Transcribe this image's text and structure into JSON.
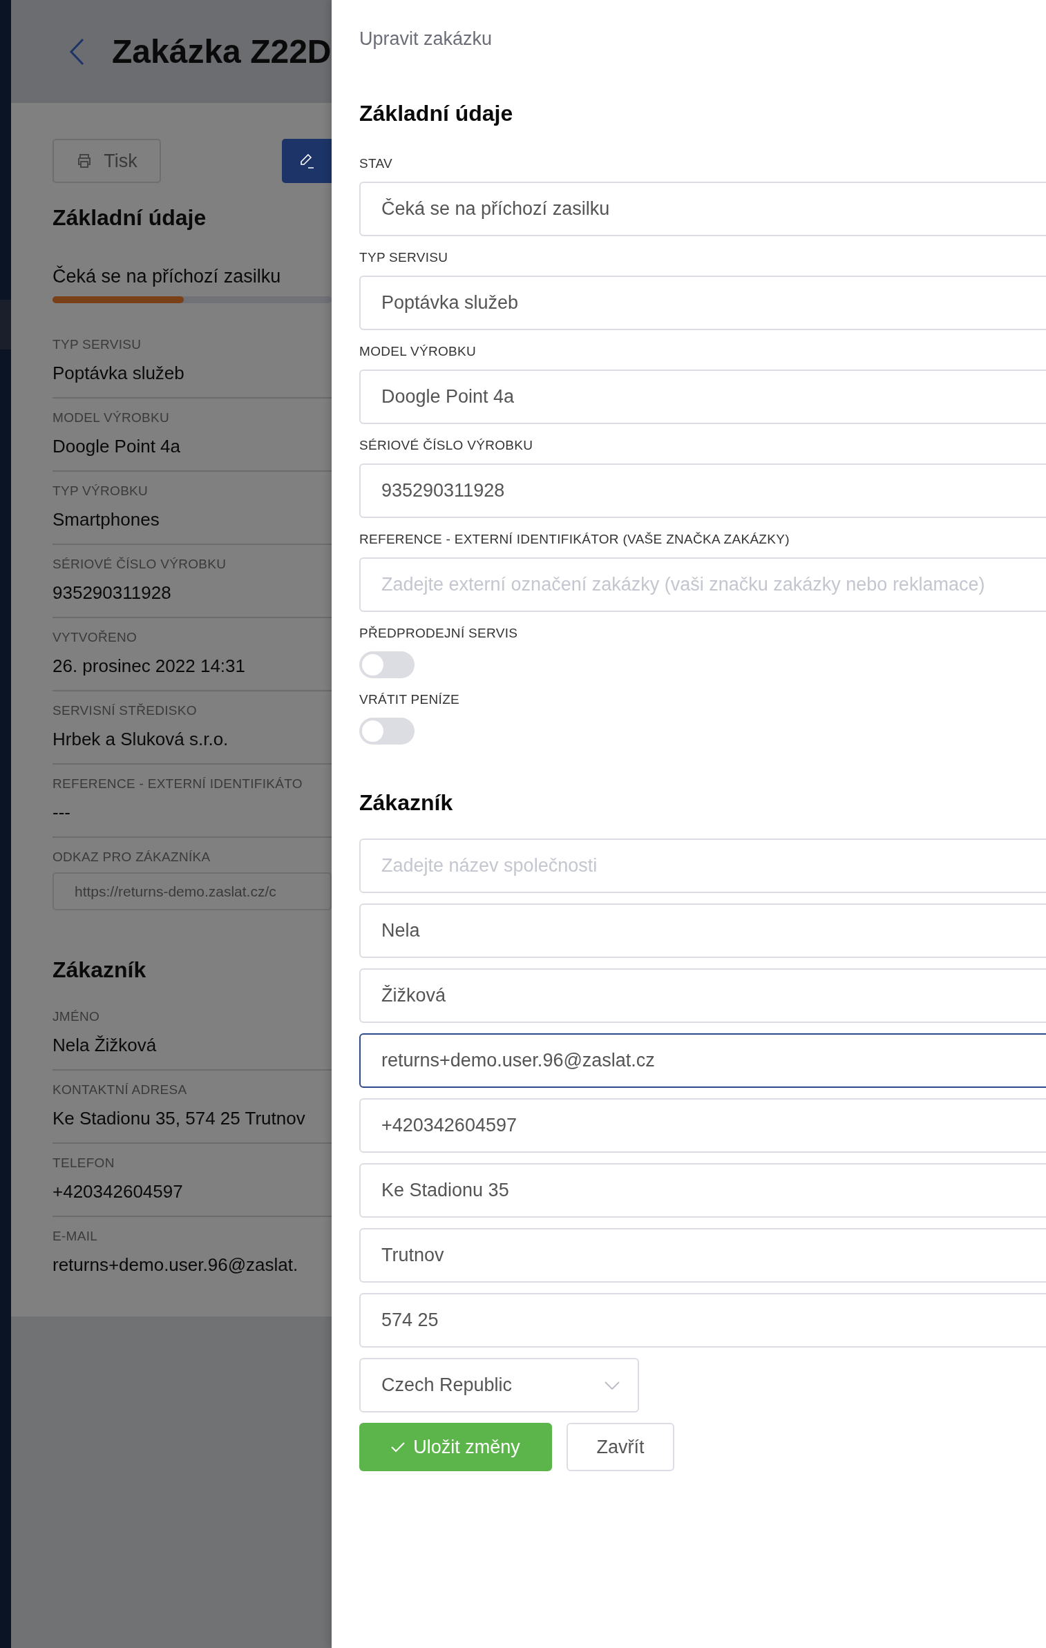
{
  "page": {
    "title": "Zakázka Z22D",
    "toolbar": [
      {
        "kind": "print",
        "label": "Tisk"
      },
      {
        "kind": "edit"
      }
    ],
    "basic": {
      "heading": "Základní údaje",
      "status": "Čeká se na příchozí zasilku",
      "level": 0.47,
      "rows": [
        {
          "kind": "value",
          "label": "TYP SERVISU",
          "value": "Poptávka služeb"
        },
        {
          "kind": "value",
          "label": "MODEL VÝROBKU",
          "value": "Doogle Point 4a"
        },
        {
          "kind": "value",
          "label": "TYP VÝROBKU",
          "value": "Smartphones"
        },
        {
          "kind": "value",
          "label": "SÉRIOVÉ ČÍSLO VÝROBKU",
          "value": "935290311928"
        },
        {
          "kind": "value",
          "label": "VYTVOŘENO",
          "value": "26. prosinec 2022 14:31"
        },
        {
          "kind": "value",
          "label": "SERVISNÍ STŘEDISKO",
          "value": "Hrbek a Sluková s.r.o."
        },
        {
          "kind": "value",
          "label": "REFERENCE - EXTERNÍ IDENTIFIKÁTO",
          "value": "---"
        },
        {
          "kind": "link",
          "label": "ODKAZ PRO ZÁKAZNÍKA",
          "value": "https://returns-demo.zaslat.cz/c"
        }
      ]
    },
    "customer": {
      "heading": "Zákazník",
      "rows": [
        {
          "kind": "value",
          "label": "JMÉNO",
          "value": "Nela Žižková"
        },
        {
          "kind": "value",
          "label": "KONTAKTNÍ ADRESA",
          "value": "Ke Stadionu 35, 574 25 Trutnov"
        },
        {
          "kind": "value",
          "label": "TELEFON",
          "value": "+420342604597"
        },
        {
          "kind": "value",
          "label": "E-MAIL",
          "value": "returns+demo.user.96@zaslat."
        }
      ]
    }
  },
  "drawer": {
    "title": "Upravit zakázku",
    "basic": {
      "heading": "Základní údaje",
      "fields": [
        {
          "kind": "text",
          "label": "STAV",
          "value": "Čeká se na příchozí zasilku"
        },
        {
          "kind": "text",
          "label": "TYP SERVISU",
          "value": "Poptávka služeb"
        },
        {
          "kind": "text",
          "label": "MODEL VÝROBKU",
          "value": "Doogle Point 4a"
        },
        {
          "kind": "text",
          "label": "SÉRIOVÉ ČÍSLO VÝROBKU",
          "value": "935290311928"
        },
        {
          "kind": "text",
          "label": "REFERENCE - EXTERNÍ IDENTIFIKÁTOR (VAŠE ZNAČKA ZAKÁZKY)",
          "placeholder": "Zadejte externí označení zakázky (vaši značku zakázky nebo reklamace)"
        },
        {
          "kind": "toggle",
          "label": "PŘEDPRODEJNÍ SERVIS",
          "on": false
        },
        {
          "kind": "toggle",
          "label": "VRÁTIT PENÍZE",
          "on": false
        }
      ]
    },
    "customer": {
      "heading": "Zákazník",
      "fields": [
        {
          "kind": "text",
          "placeholder": "Zadejte název společnosti"
        },
        {
          "kind": "text",
          "value": "Nela"
        },
        {
          "kind": "text",
          "value": "Žižková"
        },
        {
          "kind": "text",
          "value": "returns+demo.user.96@zaslat.cz",
          "focused": true
        },
        {
          "kind": "text",
          "value": "+420342604597"
        },
        {
          "kind": "text",
          "value": "Ke Stadionu 35"
        },
        {
          "kind": "text",
          "value": "Trutnov"
        },
        {
          "kind": "text",
          "value": "574 25"
        },
        {
          "kind": "select",
          "value": "Czech Republic"
        }
      ]
    },
    "actions": [
      {
        "kind": "primary",
        "label": "Uložit změny"
      },
      {
        "kind": "secondary",
        "label": "Zavřít"
      }
    ]
  }
}
